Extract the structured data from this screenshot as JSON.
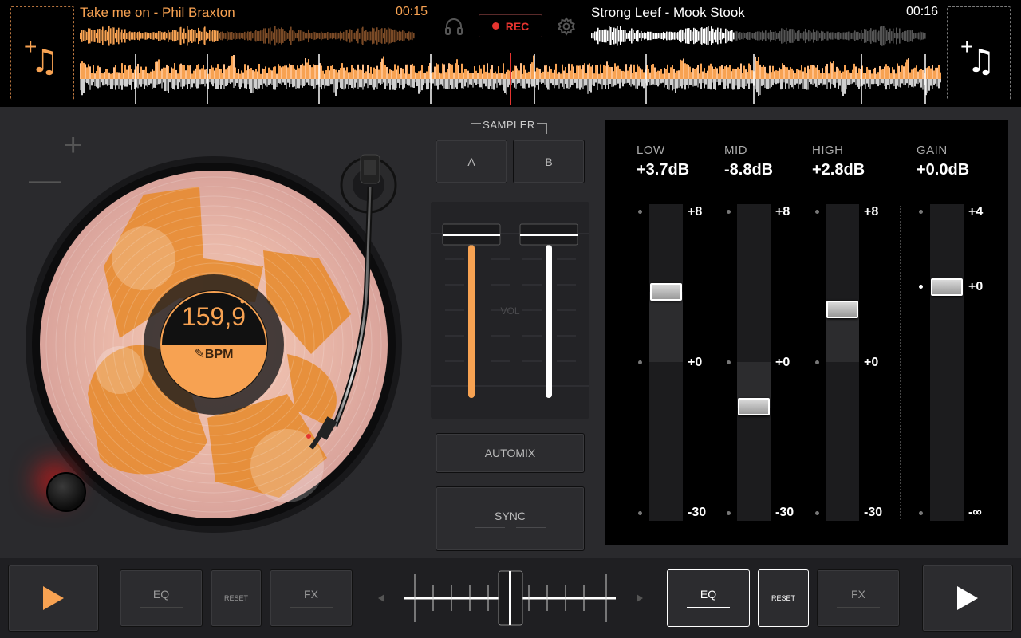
{
  "top": {
    "left_deck": {
      "title": "Take me on - Phil Braxton",
      "time": "00:15"
    },
    "right_deck": {
      "title": "Strong Leef - Mook Stook",
      "time": "00:16"
    },
    "rec_label": "REC",
    "load_plus": "+",
    "load_note": "♫"
  },
  "deck": {
    "bpm_value": "159,9",
    "bpm_label": "✎BPM",
    "pitch_plus": "+",
    "pitch_minus": "—"
  },
  "mixer": {
    "sampler_label": "SAMPLER",
    "sampler_a": "A",
    "sampler_b": "B",
    "vol_label": "VOL",
    "automix": "AUTOMIX",
    "sync": "SYNC",
    "volume_left": 1.0,
    "volume_right": 1.0
  },
  "eq": {
    "bands": [
      {
        "name": "LOW",
        "value": "+3.7dB",
        "top": "+8",
        "mid": "+0",
        "bottom": "-30"
      },
      {
        "name": "MID",
        "value": "-8.8dB",
        "top": "+8",
        "mid": "+0",
        "bottom": "-30"
      },
      {
        "name": "HIGH",
        "value": "+2.8dB",
        "top": "+8",
        "mid": "+0",
        "bottom": "-30"
      }
    ],
    "gain": {
      "name": "GAIN",
      "value": "+0.0dB",
      "top": "+4",
      "mid": "+0",
      "bottom": "-∞"
    }
  },
  "bottom": {
    "eq_label": "EQ",
    "reset_label": "RESET",
    "fx_label": "FX",
    "play_icon": "play-icon"
  },
  "colors": {
    "accent_left": "#f7a252",
    "accent_right": "#ffffff",
    "rec": "#e5342f"
  }
}
